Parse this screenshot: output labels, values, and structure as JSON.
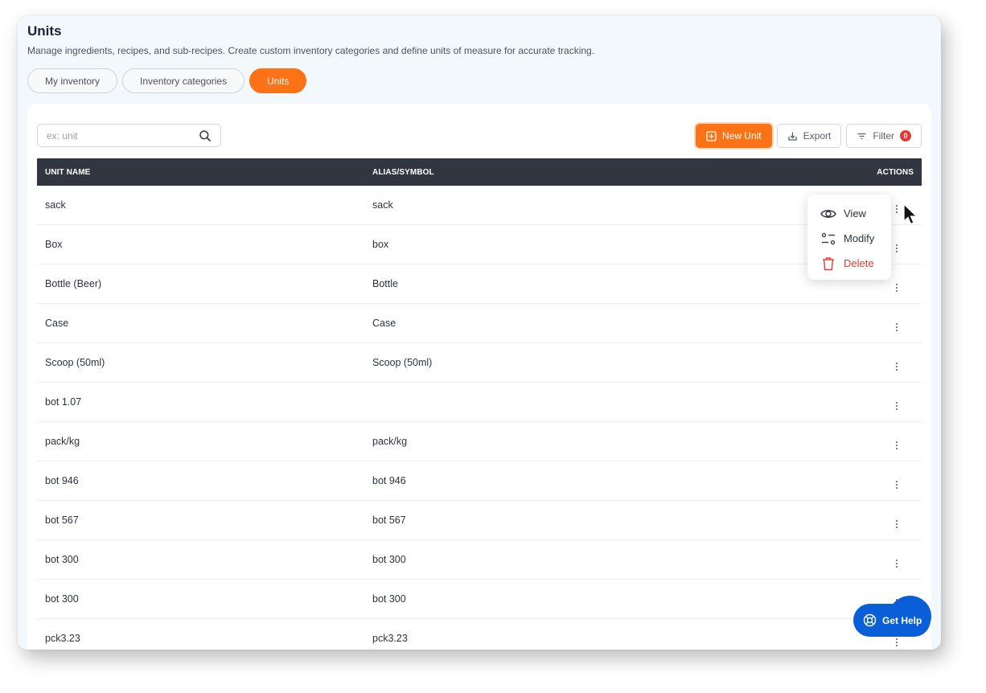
{
  "header": {
    "title": "Units",
    "description": "Manage ingredients, recipes, and sub-recipes. Create custom inventory categories and define units of measure for accurate tracking."
  },
  "tabs": [
    {
      "label": "My inventory"
    },
    {
      "label": "Inventory categories"
    },
    {
      "label": "Units"
    }
  ],
  "search": {
    "placeholder": "ex: unit"
  },
  "toolbar": {
    "new_label": "New Unit",
    "export_label": "Export",
    "filter_label": "Filter",
    "filter_count": "0"
  },
  "table": {
    "headers": [
      "UNIT NAME",
      "ALIAS/SYMBOL",
      "ACTIONS"
    ],
    "rows": [
      {
        "name": "sack",
        "alias": "sack"
      },
      {
        "name": "Box",
        "alias": "box"
      },
      {
        "name": "Bottle (Beer)",
        "alias": "Bottle"
      },
      {
        "name": "Case",
        "alias": "Case"
      },
      {
        "name": "Scoop (50ml)",
        "alias": "Scoop (50ml)"
      },
      {
        "name": "bot 1.07",
        "alias": ""
      },
      {
        "name": "pack/kg",
        "alias": "pack/kg"
      },
      {
        "name": "bot 946",
        "alias": "bot 946"
      },
      {
        "name": "bot 567",
        "alias": "bot 567"
      },
      {
        "name": "bot 300",
        "alias": "bot 300"
      },
      {
        "name": "bot 300",
        "alias": "bot 300"
      },
      {
        "name": "pck3.23",
        "alias": "pck3.23"
      }
    ]
  },
  "menu": {
    "view_label": "View",
    "modify_label": "Modify",
    "delete_label": "Delete"
  },
  "help": {
    "label": "Get Help"
  },
  "colors": {
    "accent": "#fb7217",
    "header_bg": "#313640",
    "danger": "#e53935",
    "help_bg": "#0a5fd8"
  }
}
